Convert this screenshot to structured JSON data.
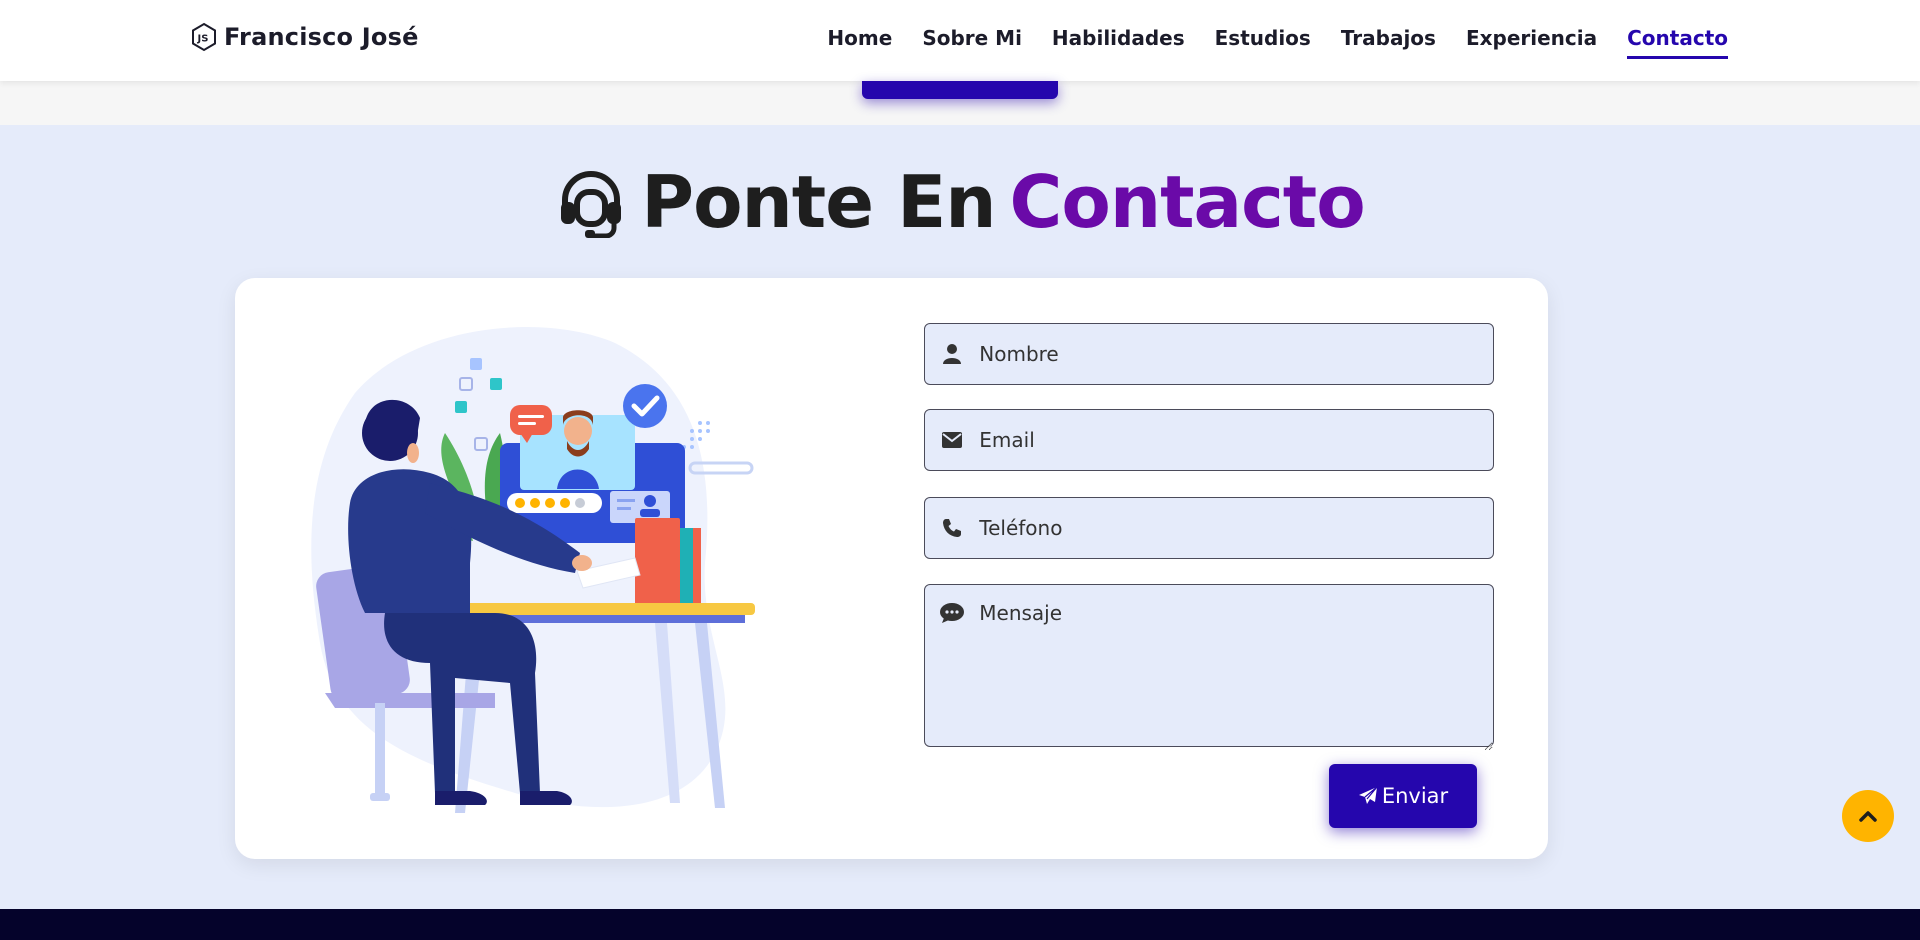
{
  "brand": {
    "name": "Francisco José",
    "icon": "nodejs-hexagon-icon"
  },
  "nav": {
    "items": [
      {
        "label": "Home"
      },
      {
        "label": "Sobre Mi"
      },
      {
        "label": "Habilidades"
      },
      {
        "label": "Estudios"
      },
      {
        "label": "Trabajos"
      },
      {
        "label": "Experiencia"
      },
      {
        "label": "Contacto",
        "active": true
      }
    ]
  },
  "contact": {
    "heading_icon": "headset-icon",
    "heading_text": "Ponte En",
    "heading_accent": "Contacto",
    "form": {
      "name_placeholder": "Nombre",
      "email_placeholder": "Email",
      "phone_placeholder": "Teléfono",
      "message_placeholder": "Mensaje",
      "submit_label": "Enviar"
    }
  },
  "colors": {
    "accent": "#2506ad",
    "heading_accent": "#6a0aa8",
    "section_bg": "#e5ebfa",
    "scroll_top": "#ffb400",
    "footer": "#05032b"
  }
}
